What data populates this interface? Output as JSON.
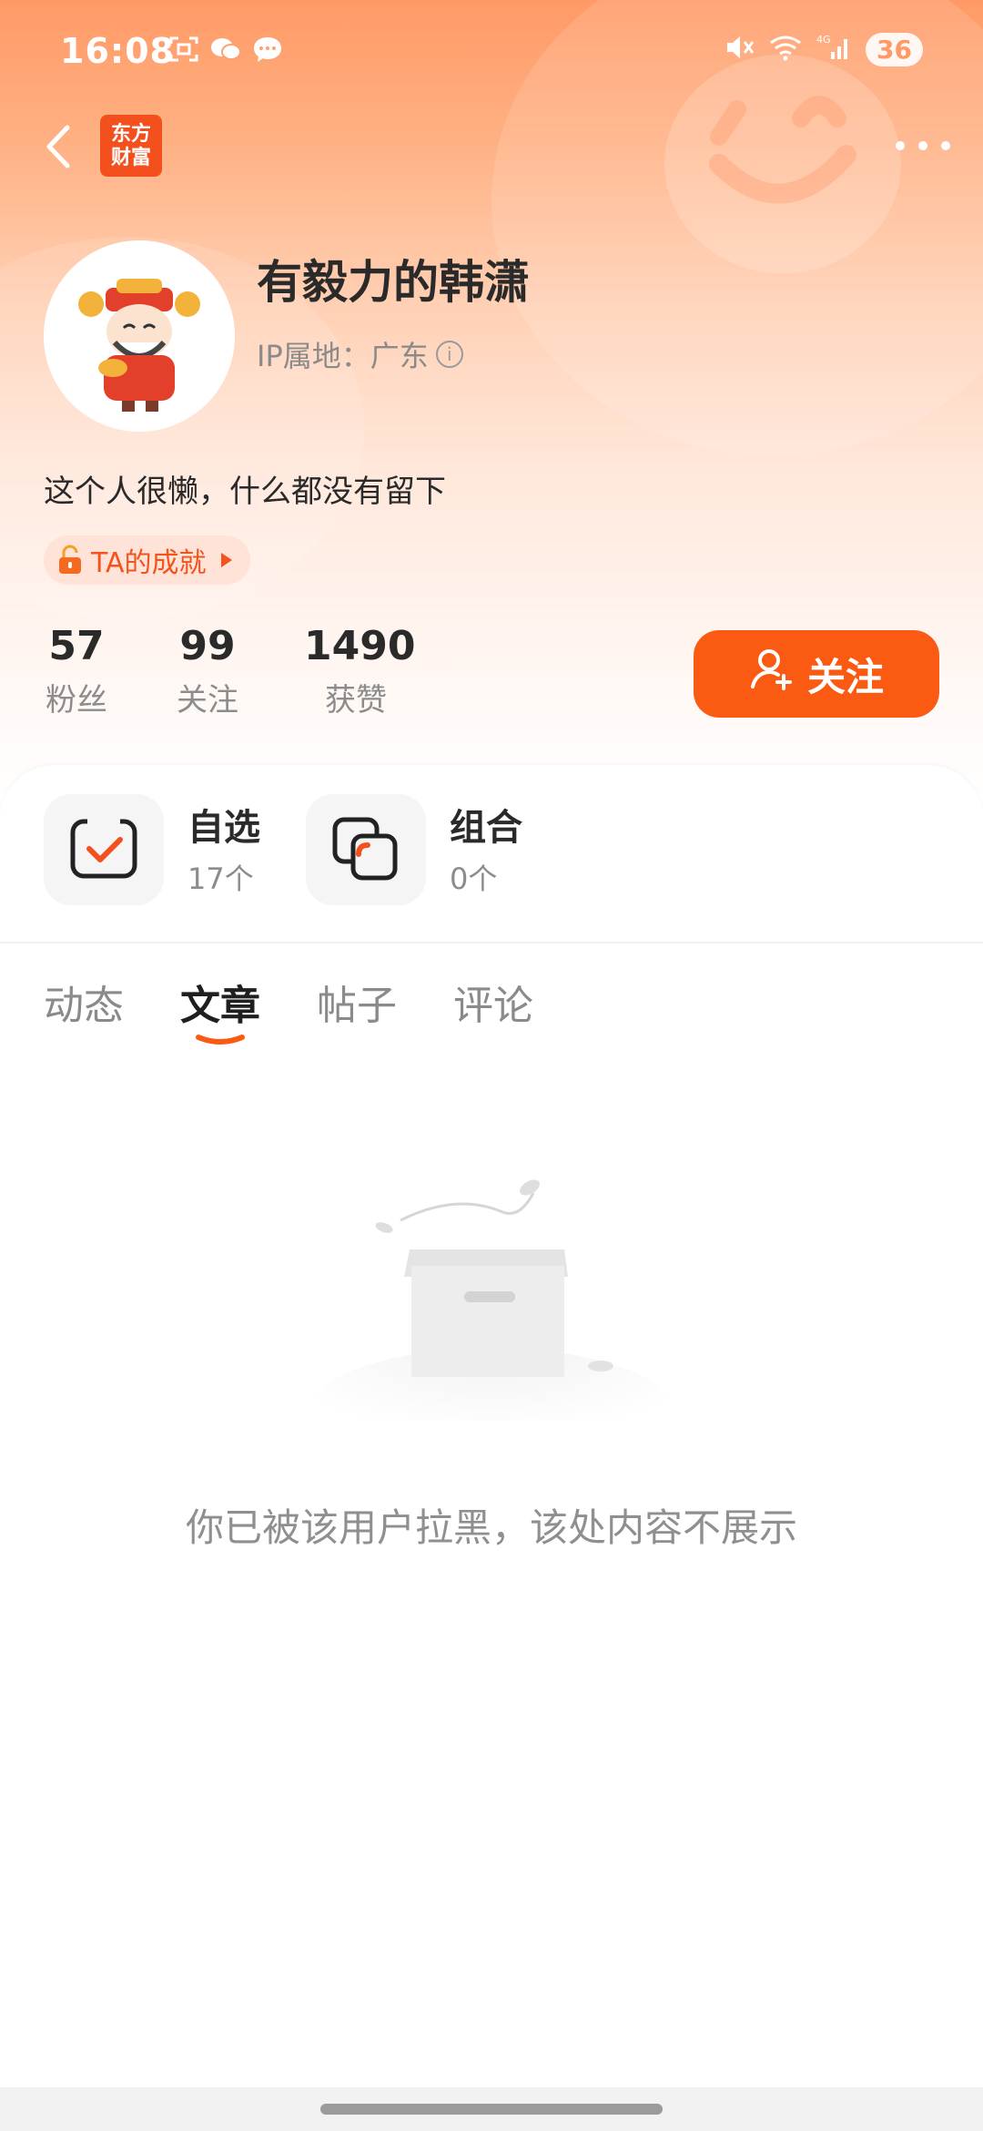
{
  "status_bar": {
    "time": "16:08",
    "battery": "36",
    "network": "4G"
  },
  "header": {
    "logo_text": "东方财富"
  },
  "profile": {
    "name": "有毅力的韩潇",
    "ip_label": "IP属地：广东",
    "bio": "这个人很懒，什么都没有留下",
    "achievement_label": "TA的成就"
  },
  "stats": [
    {
      "value": "57",
      "label": "粉丝"
    },
    {
      "value": "99",
      "label": "关注"
    },
    {
      "value": "1490",
      "label": "获赞"
    }
  ],
  "follow_button": {
    "label": "关注"
  },
  "cards": [
    {
      "title": "自选",
      "sub": "17个"
    },
    {
      "title": "组合",
      "sub": "0个"
    }
  ],
  "tabs": [
    {
      "label": "动态"
    },
    {
      "label": "文章"
    },
    {
      "label": "帖子"
    },
    {
      "label": "评论"
    }
  ],
  "active_tab": "文章",
  "empty_message": "你已被该用户拉黑，该处内容不展示",
  "colors": {
    "accent": "#fa5a12",
    "brand": "#f4501e"
  }
}
